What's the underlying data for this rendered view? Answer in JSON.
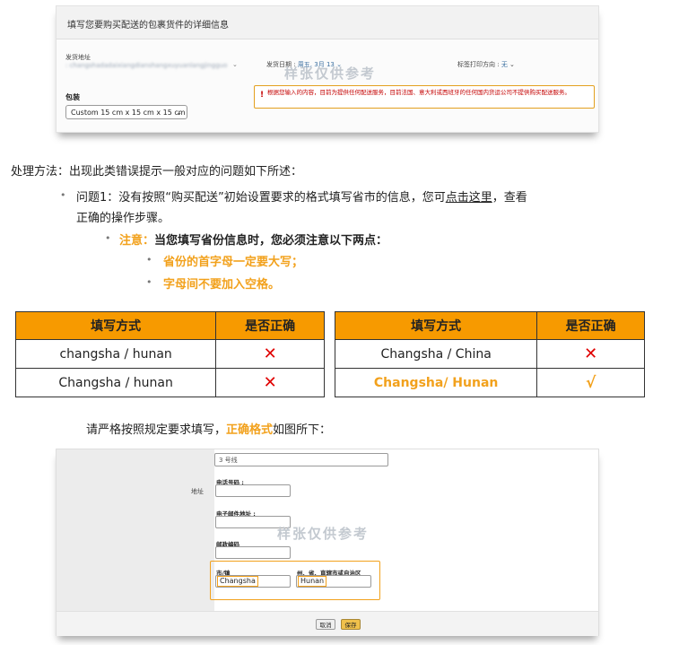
{
  "shot1": {
    "title": "填写您要购买配送的包裹货件的详细信息",
    "ship_from_label": "发货地址",
    "ship_from_value": ": changshadadaixiangdianshangxuyuanlangjingguo",
    "ship_date_label": "发货日期 : ",
    "ship_date_value": "周五, 3月 13",
    "print_label": "标签打印方向 : ",
    "print_value": "无",
    "package_label": "包装",
    "package_select": "Custom 15 cm x 15 cm x 15 cm",
    "warning_icon": "!",
    "warning_text": "根据您输入的内容，目前为提供任何配送服务，目前法国、意大利或西班牙的任何国内货运公司不提供购买配送服务。",
    "watermark": "样张仅供参考"
  },
  "text": {
    "method": "处理方法：出现此类错误提示一般对应的问题如下所述：",
    "bullet": "•",
    "item1_prefix": "问题1：没有按照“购买配送”初始设置要求的格式填写省市的信息，您可",
    "item1_link": "点击这里",
    "item1_suffix": "，查看",
    "item1_line2": "正确的操作步骤。",
    "note_label": "注意：",
    "note_text": "当您填写省份信息时，您必须注意以下两点：",
    "sub1": "省份的首字母一定要大写；",
    "sub2": "字母间不要加入空格。",
    "strict_prefix": "请严格按照规定要求填写，",
    "strict_highlight": "正确格式",
    "strict_suffix": "如图所下："
  },
  "tables": {
    "header_method": "填写方式",
    "header_correct": "是否正确",
    "left_rows": [
      {
        "method": "changsha / hunan",
        "mark": "✕"
      },
      {
        "method": "Changsha / hunan",
        "mark": "✕"
      }
    ],
    "right_rows": [
      {
        "method": "Changsha / China",
        "mark": "✕"
      },
      {
        "method": "Changsha/ Hunan",
        "mark": "√"
      }
    ]
  },
  "shot2": {
    "street2_value": "3 号线",
    "address_label": "地址",
    "phone_label": "电话号码 :",
    "email_label": "电子邮件地址 :",
    "postcode_label": "邮政编码",
    "city_label": "市/镇",
    "state_label": "州、省、直辖市或自治区",
    "city_value": "Changsha",
    "state_value": "Hunan",
    "cancel_label": "取消",
    "save_label": "保存",
    "watermark": "样张仅供参考"
  },
  "colors": {
    "accent_orange": "#f79a00",
    "error_red": "#e00000",
    "highlight_orange": "#f2a11c"
  }
}
